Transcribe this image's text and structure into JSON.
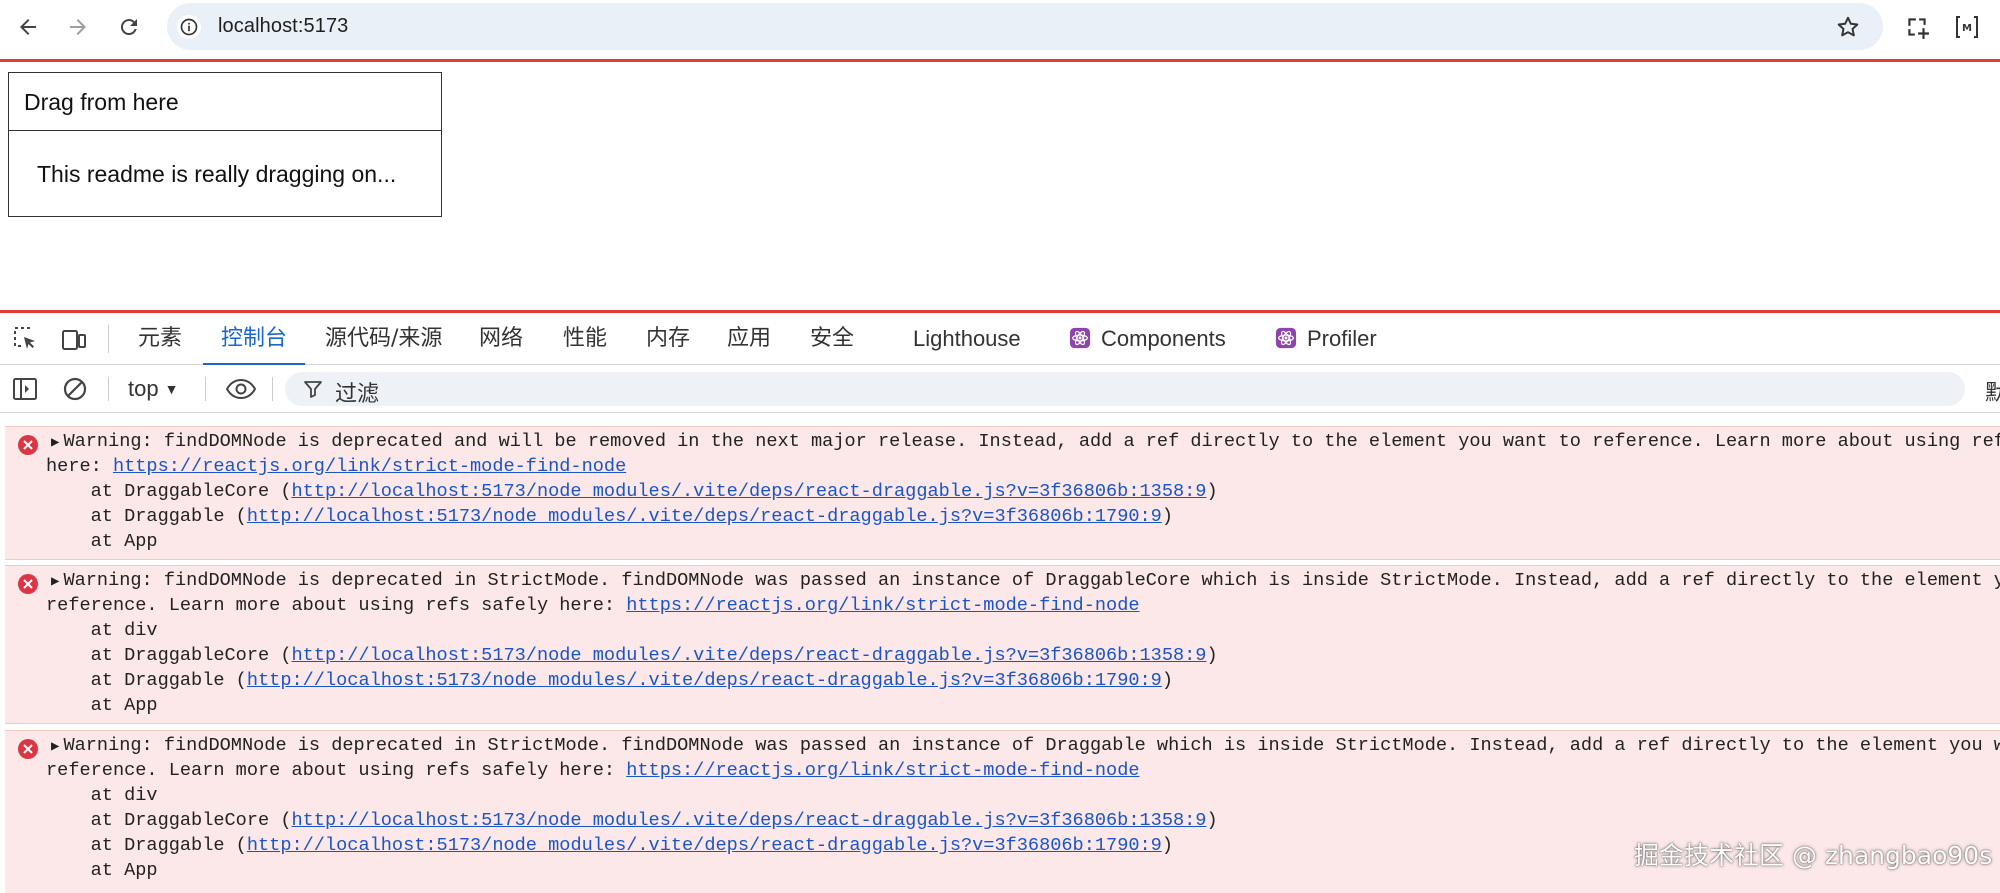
{
  "browser": {
    "url": "localhost:5173",
    "buttons": {
      "back": "back-arrow-icon",
      "forward": "forward-arrow-icon",
      "reload": "reload-icon",
      "site_info": "info-icon",
      "bookmark": "star-icon",
      "screenshot": "crop-add-icon",
      "extension": "bracket-m-icon"
    },
    "accent_color": "#e53935"
  },
  "page": {
    "drag_handle": "Drag from here",
    "drag_body": "This readme is really dragging on..."
  },
  "devtools": {
    "tabs": [
      "元素",
      "控制台",
      "源代码/来源",
      "网络",
      "性能",
      "内存",
      "应用",
      "安全",
      "Lighthouse",
      "Components",
      "Profiler"
    ],
    "active_tab": "控制台",
    "context": "top",
    "filter_placeholder": "过滤",
    "right_cut_text": "默",
    "link_color": "#1a55c8",
    "error_bg": "#fce8e8"
  },
  "console": {
    "messages": [
      {
        "level": "error",
        "text_line1": "Warning: findDOMNode is deprecated and will be removed in the next major release. Instead, add a ref directly to the element you want to reference. Learn more about using refs safely",
        "text_line2_prefix": "here: ",
        "link": "https://reactjs.org/link/strict-mode-find-node",
        "stack": [
          {
            "prefix": "    at DraggableCore (",
            "url": "http://localhost:5173/node_modules/.vite/deps/react-draggable.js?v=3f36806b:1358:9",
            "suffix": ")"
          },
          {
            "prefix": "    at Draggable (",
            "url": "http://localhost:5173/node_modules/.vite/deps/react-draggable.js?v=3f36806b:1790:9",
            "suffix": ")"
          },
          {
            "prefix": "    at App",
            "url": "",
            "suffix": ""
          }
        ]
      },
      {
        "level": "error",
        "text_line1": "Warning: findDOMNode is deprecated in StrictMode. findDOMNode was passed an instance of DraggableCore which is inside StrictMode. Instead, add a ref directly to the element you want to",
        "text_line2_prefix": "reference. Learn more about using refs safely here: ",
        "link": "https://reactjs.org/link/strict-mode-find-node",
        "stack": [
          {
            "prefix": "    at div",
            "url": "",
            "suffix": ""
          },
          {
            "prefix": "    at DraggableCore (",
            "url": "http://localhost:5173/node_modules/.vite/deps/react-draggable.js?v=3f36806b:1358:9",
            "suffix": ")"
          },
          {
            "prefix": "    at Draggable (",
            "url": "http://localhost:5173/node_modules/.vite/deps/react-draggable.js?v=3f36806b:1790:9",
            "suffix": ")"
          },
          {
            "prefix": "    at App",
            "url": "",
            "suffix": ""
          }
        ]
      },
      {
        "level": "error",
        "text_line1": "Warning: findDOMNode is deprecated in StrictMode. findDOMNode was passed an instance of Draggable which is inside StrictMode. Instead, add a ref directly to the element you want to",
        "text_line2_prefix": "reference. Learn more about using refs safely here: ",
        "link": "https://reactjs.org/link/strict-mode-find-node",
        "stack": [
          {
            "prefix": "    at div",
            "url": "",
            "suffix": ""
          },
          {
            "prefix": "    at DraggableCore (",
            "url": "http://localhost:5173/node_modules/.vite/deps/react-draggable.js?v=3f36806b:1358:9",
            "suffix": ")"
          },
          {
            "prefix": "    at Draggable (",
            "url": "http://localhost:5173/node_modules/.vite/deps/react-draggable.js?v=3f36806b:1790:9",
            "suffix": ")"
          },
          {
            "prefix": "    at App",
            "url": "",
            "suffix": ""
          }
        ]
      }
    ]
  },
  "watermark": "掘金技术社区 @ zhangbao90s"
}
